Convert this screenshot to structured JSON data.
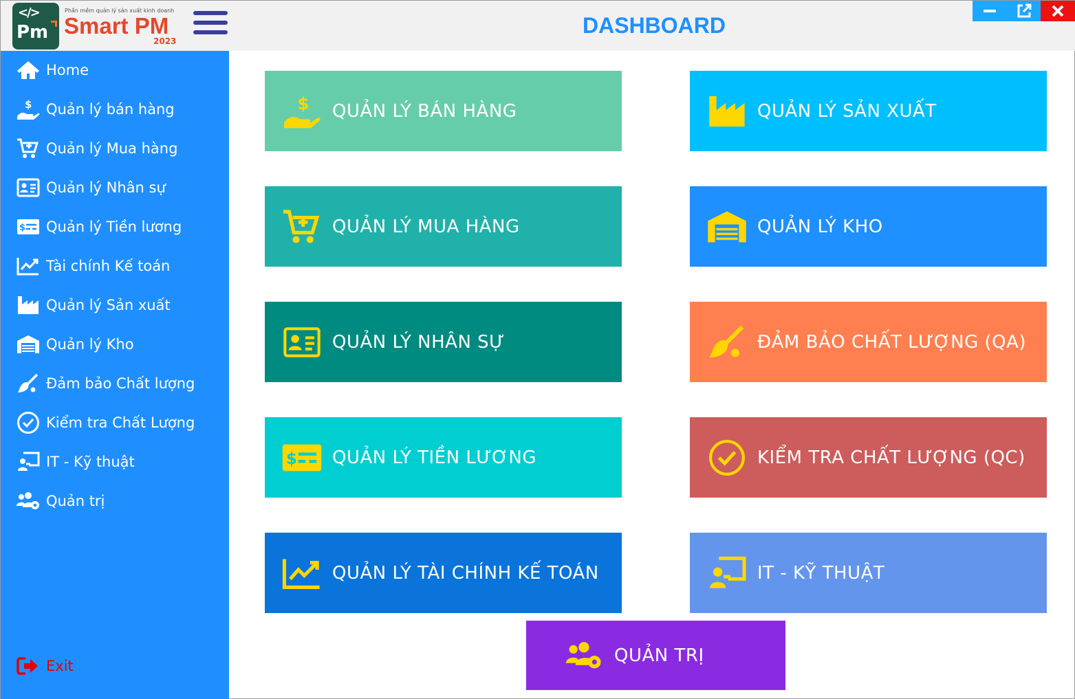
{
  "app": {
    "brand_subtitle": "Phần mềm quản lý sản xuất kinh doanh",
    "brand_name": "Smart PM",
    "brand_year": "2023",
    "logo_text": "Pm",
    "page_title": "DASHBOARD"
  },
  "window_controls": {
    "minimize_icon": "minimize-icon",
    "popout_icon": "external-link-icon",
    "close_icon": "close-icon"
  },
  "sidebar": {
    "items": [
      {
        "label": "Home",
        "icon": "home-icon"
      },
      {
        "label": "Quản lý bán hàng",
        "icon": "hand-dollar-icon"
      },
      {
        "label": "Quản lý Mua hàng",
        "icon": "cart-plus-icon"
      },
      {
        "label": "Quản lý Nhân sự",
        "icon": "id-card-icon"
      },
      {
        "label": "Quản lý Tiền lương",
        "icon": "money-check-icon"
      },
      {
        "label": "Tài chính Kế toán",
        "icon": "chart-line-icon"
      },
      {
        "label": "Quản lý Sản xuất",
        "icon": "industry-icon"
      },
      {
        "label": "Quản lý Kho",
        "icon": "warehouse-icon"
      },
      {
        "label": "Đảm bảo Chất lượng",
        "icon": "broom-icon"
      },
      {
        "label": "Kiểm tra Chất Lượng",
        "icon": "check-circle-icon"
      },
      {
        "label": "IT - Kỹ thuật",
        "icon": "chalkboard-user-icon"
      },
      {
        "label": "Quản trị",
        "icon": "users-cog-icon"
      }
    ],
    "exit_label": "Exit"
  },
  "tiles": [
    {
      "label": "QUẢN LÝ BÁN HÀNG",
      "icon": "hand-dollar-icon",
      "color": "#66cdaa"
    },
    {
      "label": "QUẢN LÝ SẢN XUẤT",
      "icon": "industry-icon",
      "color": "#00bfff"
    },
    {
      "label": "QUẢN LÝ MUA HÀNG",
      "icon": "cart-plus-icon",
      "color": "#20b2aa"
    },
    {
      "label": "QUẢN LÝ KHO",
      "icon": "warehouse-icon",
      "color": "#1e90ff"
    },
    {
      "label": "QUẢN LÝ NHÂN SỰ",
      "icon": "id-card-icon",
      "color": "#008b80"
    },
    {
      "label": "ĐẢM BẢO CHẤT LƯỢNG (QA)",
      "icon": "broom-icon",
      "color": "#ff7f50"
    },
    {
      "label": "QUẢN LÝ TIỀN LƯƠNG",
      "icon": "money-check-icon",
      "color": "#00ced1"
    },
    {
      "label": "KIỂM TRA CHẤT LƯỢNG (QC)",
      "icon": "check-circle-icon",
      "color": "#cd5c5c"
    },
    {
      "label": "QUẢN LÝ TÀI CHÍNH KẾ TOÁN",
      "icon": "chart-line-icon",
      "color": "#0a74da"
    },
    {
      "label": "IT - KỸ THUẬT",
      "icon": "chalkboard-user-icon",
      "color": "#6495ed"
    }
  ],
  "admin_tile": {
    "label": "QUẢN TRỊ",
    "icon": "users-cog-icon",
    "color": "#8a2be2"
  },
  "colors": {
    "sidebar_bg": "#1f8fff",
    "header_bg": "#f1f1f1",
    "title_blue": "#1e90ff",
    "icon_yellow": "#ffd700",
    "exit_red": "#e60000"
  }
}
